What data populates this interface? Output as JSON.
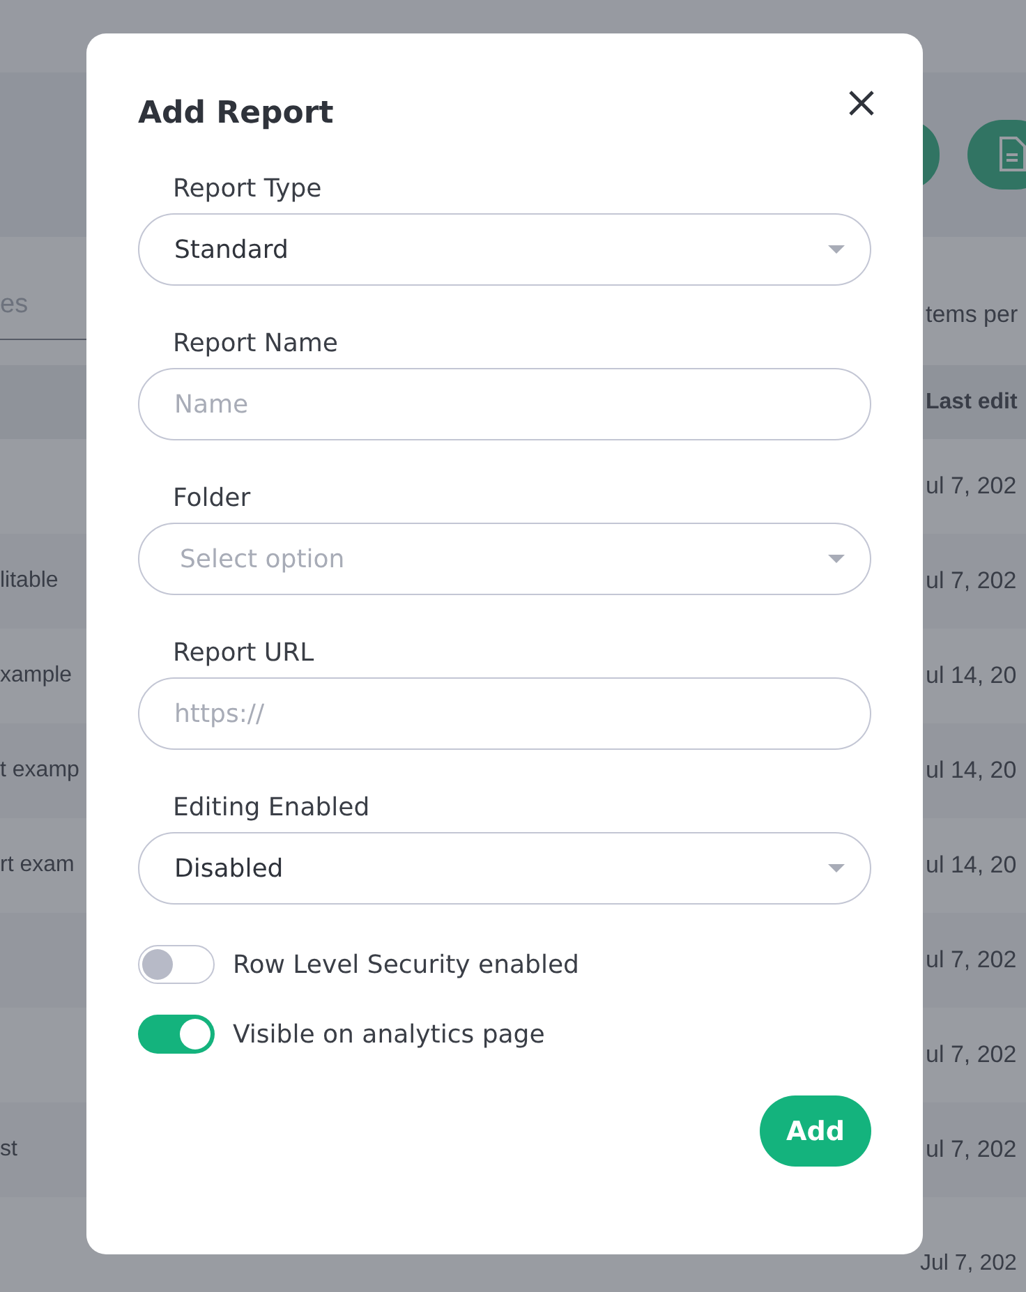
{
  "background": {
    "search": {
      "placeholder": "es"
    },
    "items_per_page_label": "tems per",
    "table": {
      "column_heading": "Last edit",
      "rows": [
        {
          "column_1": "",
          "column_2": "ul 7, 202"
        },
        {
          "column_1": "litable",
          "column_2": "ul 7, 202"
        },
        {
          "column_1": "xample",
          "column_2": "ul 14, 20"
        },
        {
          "column_1": "t examp",
          "column_2": "ul 14, 20"
        },
        {
          "column_1": "rt exam",
          "column_2": "ul 14, 20"
        },
        {
          "column_1": "",
          "column_2": "ul 7, 202"
        },
        {
          "column_1": "",
          "column_2": "ul 7, 202"
        },
        {
          "column_1": "st",
          "column_2": "ul 7, 202"
        },
        {
          "column_1": "",
          "column_2": "Jul 7, 202"
        }
      ]
    }
  },
  "dialog": {
    "title": "Add Report",
    "fields": [
      {
        "label": "Report Type",
        "kind": "select",
        "value": "Standard"
      },
      {
        "label": "Report Name",
        "kind": "text",
        "placeholder": "Name"
      },
      {
        "label": "Folder",
        "kind": "select",
        "placeholder": "Select option"
      },
      {
        "label": "Report URL",
        "kind": "text",
        "placeholder": "https://"
      },
      {
        "label": "Editing Enabled",
        "kind": "select",
        "value": "Disabled"
      }
    ],
    "toggles": [
      {
        "label": "Row Level Security enabled",
        "on": false
      },
      {
        "label": "Visible on analytics page",
        "on": true
      }
    ],
    "add_button": "Add"
  }
}
